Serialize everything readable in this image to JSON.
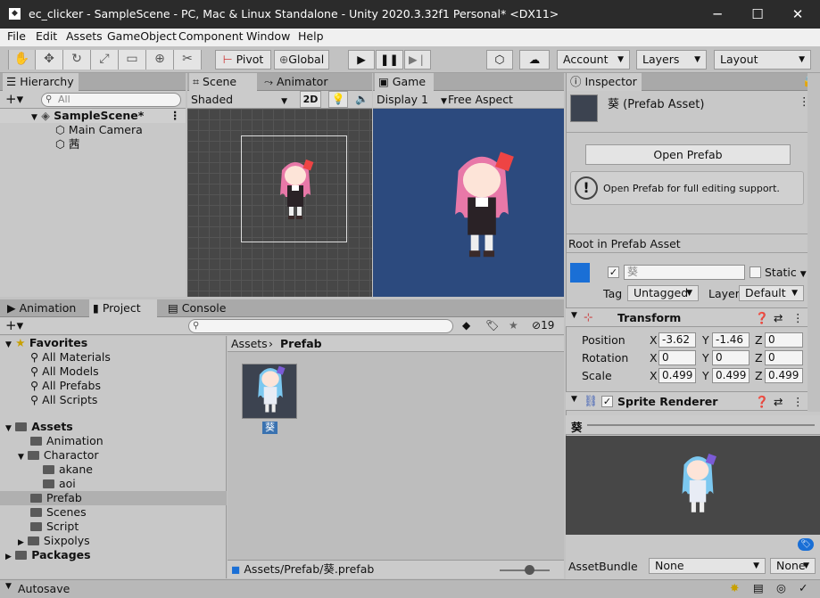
{
  "window": {
    "title": "ec_clicker - SampleScene - PC, Mac & Linux Standalone - Unity 2020.3.32f1 Personal* <DX11>"
  },
  "menu": [
    "File",
    "Edit",
    "Assets",
    "GameObject",
    "Component",
    "Window",
    "Help"
  ],
  "toolbar": {
    "pivot": "Pivot",
    "global": "Global",
    "account": "Account",
    "layers": "Layers",
    "layout": "Layout"
  },
  "hierarchy": {
    "tab": "Hierarchy",
    "search_placeholder": "All",
    "scene": "SampleScene*",
    "items": [
      "Main Camera",
      "茜"
    ]
  },
  "scene_view": {
    "tabs": [
      "Scene",
      "Animator"
    ],
    "shading": "Shaded",
    "mode_2d": "2D"
  },
  "game_view": {
    "tab": "Game",
    "display": "Display 1",
    "aspect": "Free Aspect"
  },
  "inspector": {
    "tab": "Inspector",
    "asset_title": "葵 (Prefab Asset)",
    "open_prefab": "Open Prefab",
    "help_text": "Open Prefab for full editing support.",
    "root_label": "Root in Prefab Asset",
    "object_name": "葵",
    "static_label": "Static",
    "tag_label": "Tag",
    "tag_value": "Untagged",
    "layer_label": "Layer",
    "layer_value": "Default",
    "transform": {
      "title": "Transform",
      "position": {
        "label": "Position",
        "x": "-3.62",
        "y": "-1.46",
        "z": "0"
      },
      "rotation": {
        "label": "Rotation",
        "x": "0",
        "y": "0",
        "z": "0"
      },
      "scale": {
        "label": "Scale",
        "x": "0.499",
        "y": "0.499",
        "z": "0.499"
      }
    },
    "sprite_renderer": "Sprite Renderer",
    "preview_title": "葵",
    "assetbundle_label": "AssetBundle",
    "assetbundle_value": "None",
    "assetbundle_variant": "None"
  },
  "bottom_tabs": [
    "Animation",
    "Project",
    "Console"
  ],
  "project": {
    "hidden_count": "19",
    "favorites": {
      "label": "Favorites",
      "items": [
        "All Materials",
        "All Models",
        "All Prefabs",
        "All Scripts"
      ]
    },
    "assets": {
      "label": "Assets",
      "items": [
        "Animation",
        "Charactor",
        "akane",
        "aoi",
        "Prefab",
        "Scenes",
        "Script",
        "Sixpolys"
      ]
    },
    "packages": "Packages",
    "breadcrumb": {
      "root": "Assets",
      "current": "Prefab"
    },
    "grid_item_label": "葵",
    "path": "Assets/Prefab/葵.prefab"
  },
  "statusbar": {
    "text": "Autosave"
  },
  "colors": {
    "game_bg": "#2c4a7e",
    "scene_bg": "#474747",
    "selection": "#3a72b0",
    "title_bg": "#2b2b2b"
  }
}
